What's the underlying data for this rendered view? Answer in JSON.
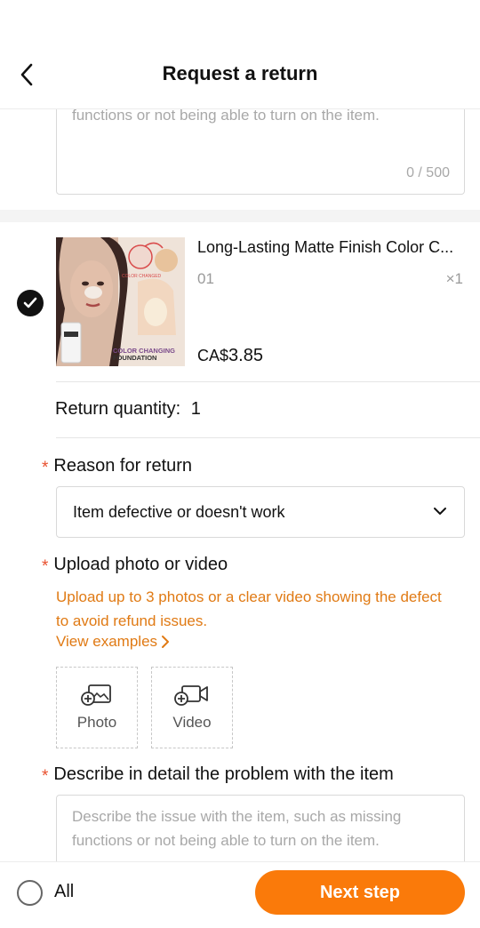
{
  "header": {
    "title": "Request a return"
  },
  "top_description": {
    "placeholder_visible": "functions or not being able to turn on the item.",
    "counter": "0 / 500"
  },
  "item": {
    "title": "Long-Lasting Matte Finish Color C...",
    "variant": "01",
    "quantity": "×1",
    "price_currency": "CA$",
    "price_amount": "3.85",
    "image_text": {
      "color_changed": "COLOR CHANGED",
      "brand_line": "COLOR CHANGING",
      "brand_line2": "FOUNDATION"
    }
  },
  "return_quantity": {
    "label": "Return quantity:",
    "value": "1"
  },
  "reason": {
    "required_mark": "*",
    "label": "Reason for return",
    "selected": "Item defective or doesn't work"
  },
  "upload": {
    "required_mark": "*",
    "label": "Upload photo or video",
    "hint": "Upload up to 3 photos or a clear video showing the defect to avoid refund issues.",
    "view_examples": "View examples",
    "photo_label": "Photo",
    "video_label": "Video"
  },
  "describe": {
    "required_mark": "*",
    "label": "Describe in detail the problem with the item",
    "placeholder": "Describe the issue with the item, such as missing functions or not being able to turn on the item."
  },
  "footer": {
    "all_label": "All",
    "next_label": "Next step"
  },
  "colors": {
    "accent": "#fa7a0a",
    "hint": "#e07a14",
    "required": "#e8502e"
  },
  "icons": [
    "back-arrow-icon",
    "checkmark-icon",
    "chevron-down-icon",
    "chevron-right-icon",
    "add-photo-icon",
    "add-video-icon"
  ]
}
